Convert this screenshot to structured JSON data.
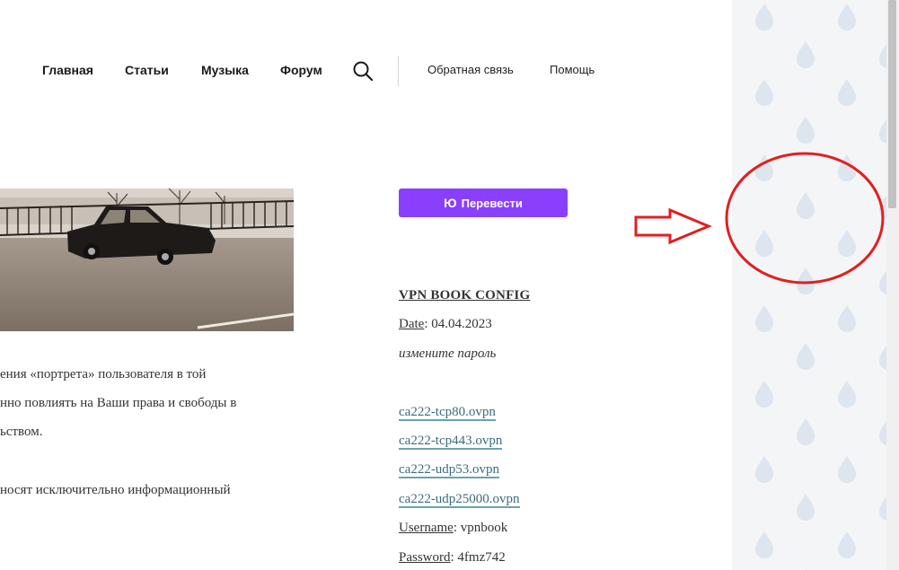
{
  "nav": {
    "items": [
      "Главная",
      "Статьи",
      "Музыка",
      "Форум"
    ],
    "secondary": [
      "Обратная связь",
      "Помощь"
    ]
  },
  "article": {
    "lines": [
      "ения «портрета» пользователя в той",
      "нно повлиять на Ваши права и свободы в",
      "ьством.",
      " носят исключительно информационный"
    ]
  },
  "translate": {
    "label": "Перевести",
    "logo": "Ю"
  },
  "vpn": {
    "title": "VPN BOOK CONFIG",
    "date_label": "Date",
    "date_value": ": 04.04.2023",
    "note": "измените пароль",
    "files": [
      "ca222-tcp80.ovpn",
      "ca222-tcp443.ovpn",
      "ca222-udp53.ovpn",
      "ca222-udp25000.ovpn"
    ],
    "username_label": "Username",
    "username_value": ": vpnbook",
    "password_label": "Password",
    "password_value": ": 4fmz742"
  },
  "colors": {
    "accent": "#8a3ffc",
    "annotation": "#e0201f",
    "link": "#3a6c7d"
  }
}
